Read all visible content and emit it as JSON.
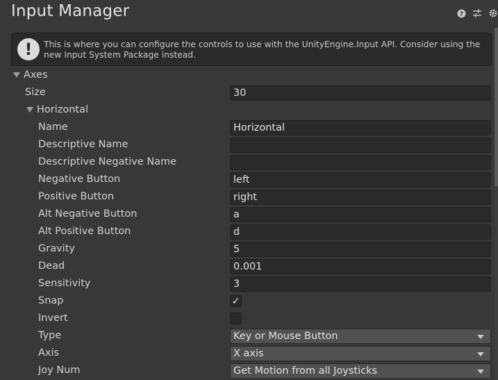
{
  "header": {
    "title": "Input Manager",
    "icons": [
      "help-icon",
      "preset-icon",
      "settings-icon"
    ]
  },
  "help_box": {
    "icon": "warning-icon",
    "text": "This is where you can configure the controls to use with the UnityEngine.Input API. Consider using the new Input System Package instead."
  },
  "axes": {
    "label": "Axes",
    "size_label": "Size",
    "size_value": "30",
    "horizontal": {
      "label": "Horizontal",
      "fields": {
        "name": {
          "label": "Name",
          "value": "Horizontal"
        },
        "descriptive_name": {
          "label": "Descriptive Name",
          "value": ""
        },
        "descriptive_negative_name": {
          "label": "Descriptive Negative Name",
          "value": ""
        },
        "negative_button": {
          "label": "Negative Button",
          "value": "left"
        },
        "positive_button": {
          "label": "Positive Button",
          "value": "right"
        },
        "alt_negative_button": {
          "label": "Alt Negative Button",
          "value": "a"
        },
        "alt_positive_button": {
          "label": "Alt Positive Button",
          "value": "d"
        },
        "gravity": {
          "label": "Gravity",
          "value": "5"
        },
        "dead": {
          "label": "Dead",
          "value": "0.001"
        },
        "sensitivity": {
          "label": "Sensitivity",
          "value": "3"
        },
        "snap": {
          "label": "Snap",
          "checked": true,
          "mark": "✓"
        },
        "invert": {
          "label": "Invert",
          "checked": false,
          "mark": ""
        },
        "type": {
          "label": "Type",
          "value": "Key or Mouse Button"
        },
        "axis": {
          "label": "Axis",
          "value": "X axis"
        },
        "joy_num": {
          "label": "Joy Num",
          "value": "Get Motion from all Joysticks"
        }
      }
    }
  }
}
